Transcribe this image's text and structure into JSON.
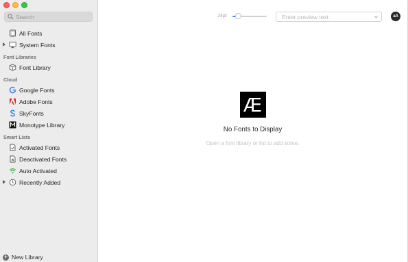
{
  "sidebar": {
    "search_placeholder": "Search",
    "items_top": [
      {
        "label": "All Fonts",
        "icon": "all-fonts-icon"
      },
      {
        "label": "System Fonts",
        "icon": "monitor-icon",
        "expandable": true
      }
    ],
    "font_libraries": {
      "heading": "Font Libraries",
      "items": [
        {
          "label": "Font Library",
          "icon": "cube-icon"
        }
      ]
    },
    "cloud": {
      "heading": "Cloud",
      "items": [
        {
          "label": "Google Fonts",
          "icon": "google-icon",
          "color": "#4285f4"
        },
        {
          "label": "Adobe Fonts",
          "icon": "adobe-icon",
          "color": "#e1251b"
        },
        {
          "label": "SkyFonts",
          "icon": "skyfonts-icon",
          "color": "#1e88e5"
        },
        {
          "label": "Monotype Library",
          "icon": "monotype-icon",
          "color": "#000000"
        }
      ]
    },
    "smart_lists": {
      "heading": "Smart Lists",
      "items": [
        {
          "label": "Activated Fonts",
          "icon": "activated-doc-icon"
        },
        {
          "label": "Deactivated Fonts",
          "icon": "deactivated-doc-icon"
        },
        {
          "label": "Auto Activated",
          "icon": "wifi-icon",
          "color": "#3cb34a"
        },
        {
          "label": "Recently Added",
          "icon": "clock-icon",
          "expandable": true
        }
      ]
    },
    "new_library_label": "New Library"
  },
  "toolbar": {
    "size_label": "24pt",
    "size_slider_value": 0.15,
    "preview_placeholder": "Enter preview text",
    "aa_label": "aA",
    "accent_color": "#3f8df6"
  },
  "empty_state": {
    "logo_glyph": "Æ",
    "title": "No Fonts to Display",
    "subtitle": "Open a font library or list to add some."
  }
}
